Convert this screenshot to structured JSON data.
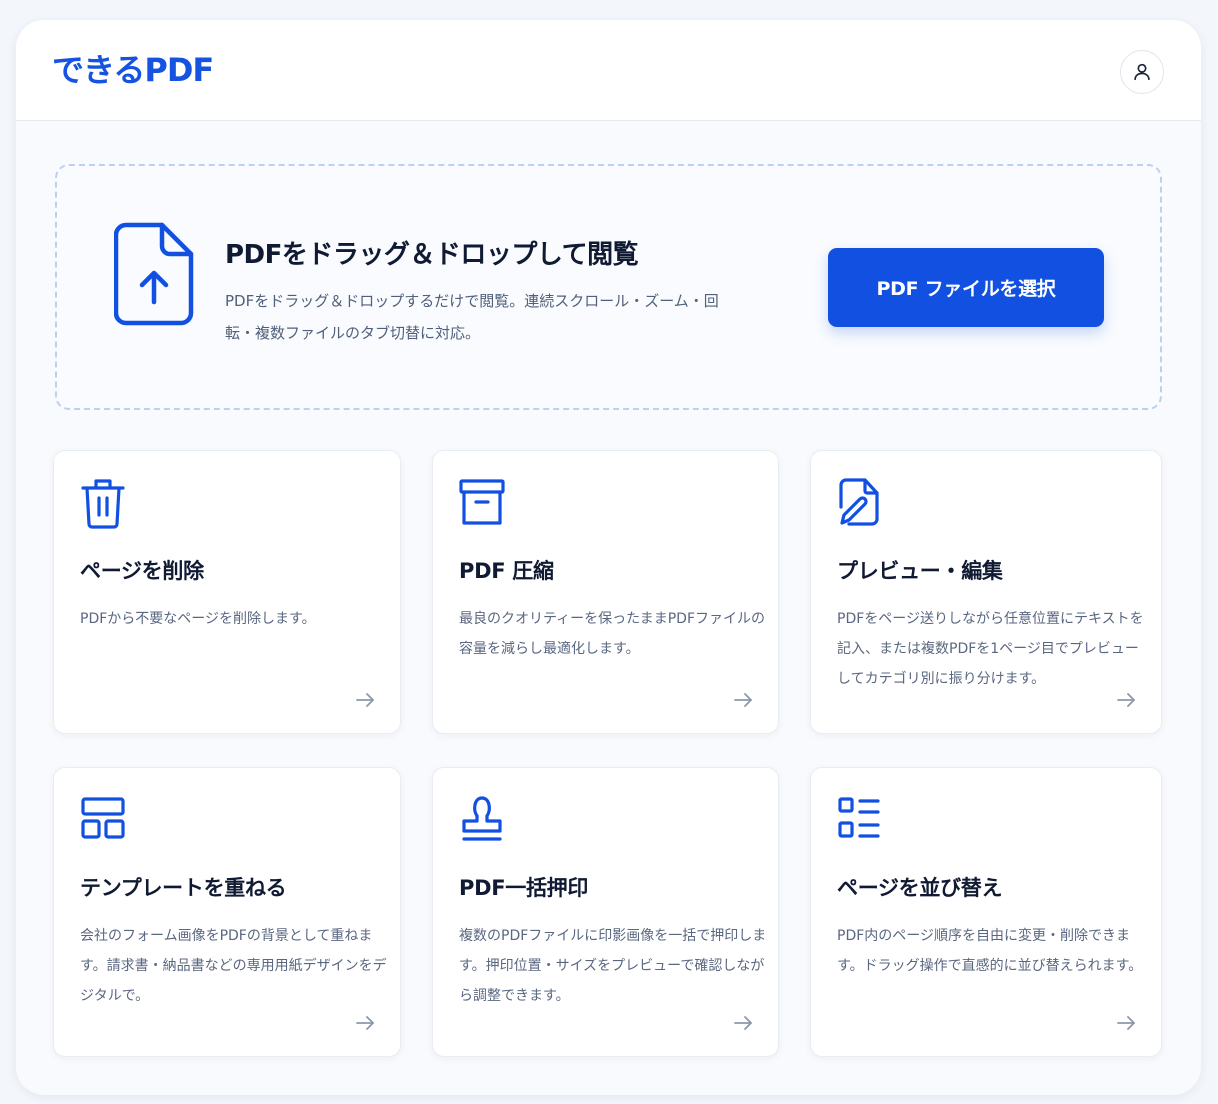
{
  "app": {
    "logo": "できるPDF"
  },
  "header": {
    "account_icon": "user-icon"
  },
  "dropzone": {
    "icon": "file-upload-icon",
    "title": "PDFをドラッグ＆ドロップして閲覧",
    "description": "PDFをドラッグ＆ドロップするだけで閲覧。連続スクロール・ズーム・回転・複数ファイルのタブ切替に対応。",
    "button_label": "PDF ファイルを選択"
  },
  "features": [
    {
      "icon": "trash-icon",
      "title": "ページを削除",
      "description": "PDFから不要なページを削除します。"
    },
    {
      "icon": "archive-icon",
      "title": "PDF 圧縮",
      "description": "最良のクオリティーを保ったままPDFファイルの容量を減らし最適化します。"
    },
    {
      "icon": "file-edit-icon",
      "title": "プレビュー・編集",
      "description": "PDFをページ送りしながら任意位置にテキストを記入、または複数PDFを1ページ目でプレビューしてカテゴリ別に振り分けます。"
    },
    {
      "icon": "template-layout-icon",
      "title": "テンプレートを重ねる",
      "description": "会社のフォーム画像をPDFの背景として重ねます。請求書・納品書などの専用用紙デザインをデジタルで。"
    },
    {
      "icon": "stamp-icon",
      "title": "PDF一括押印",
      "description": "複数のPDFファイルに印影画像を一括で押印します。押印位置・サイズをプレビューで確認しながら調整できます。"
    },
    {
      "icon": "list-reorder-icon",
      "title": "ページを並び替え",
      "description": "PDF内のページ順序を自由に変更・削除できます。ドラッグ操作で直感的に並び替えられます。"
    }
  ],
  "colors": {
    "accent": "#1150e0",
    "logo": "#1553e0",
    "text": "#101a33",
    "muted": "#5a6780"
  }
}
